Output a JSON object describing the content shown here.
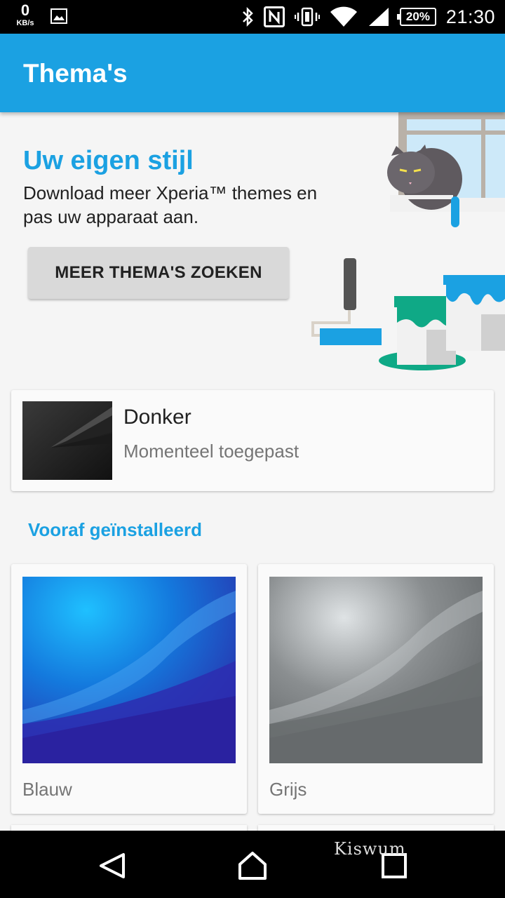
{
  "status_bar": {
    "net_speed": "0",
    "net_unit": "KB/s",
    "battery": "20%",
    "time": "21:30",
    "icons": [
      "image-icon",
      "bluetooth-icon",
      "nfc-icon",
      "vibrate-icon",
      "wifi-icon",
      "signal-icon",
      "battery-icon"
    ]
  },
  "app_bar": {
    "title": "Thema's"
  },
  "hero": {
    "title": "Uw eigen stijl",
    "description": "Download meer Xperia™ themes en pas uw apparaat aan.",
    "button_label": "MEER THEMA'S ZOEKEN"
  },
  "current_theme": {
    "name": "Donker",
    "status": "Momenteel toegepast"
  },
  "preinstalled": {
    "heading": "Vooraf geïnstalleerd",
    "themes": [
      {
        "name": "Blauw",
        "color": "#1565c0"
      },
      {
        "name": "Grijs",
        "color": "#8a8e90"
      }
    ]
  },
  "nav_bar": {
    "icons": [
      "back-icon",
      "home-icon",
      "recents-icon"
    ],
    "watermark": "Kiswum"
  },
  "colors": {
    "accent": "#1ba1e2",
    "background": "#f5f5f5"
  }
}
